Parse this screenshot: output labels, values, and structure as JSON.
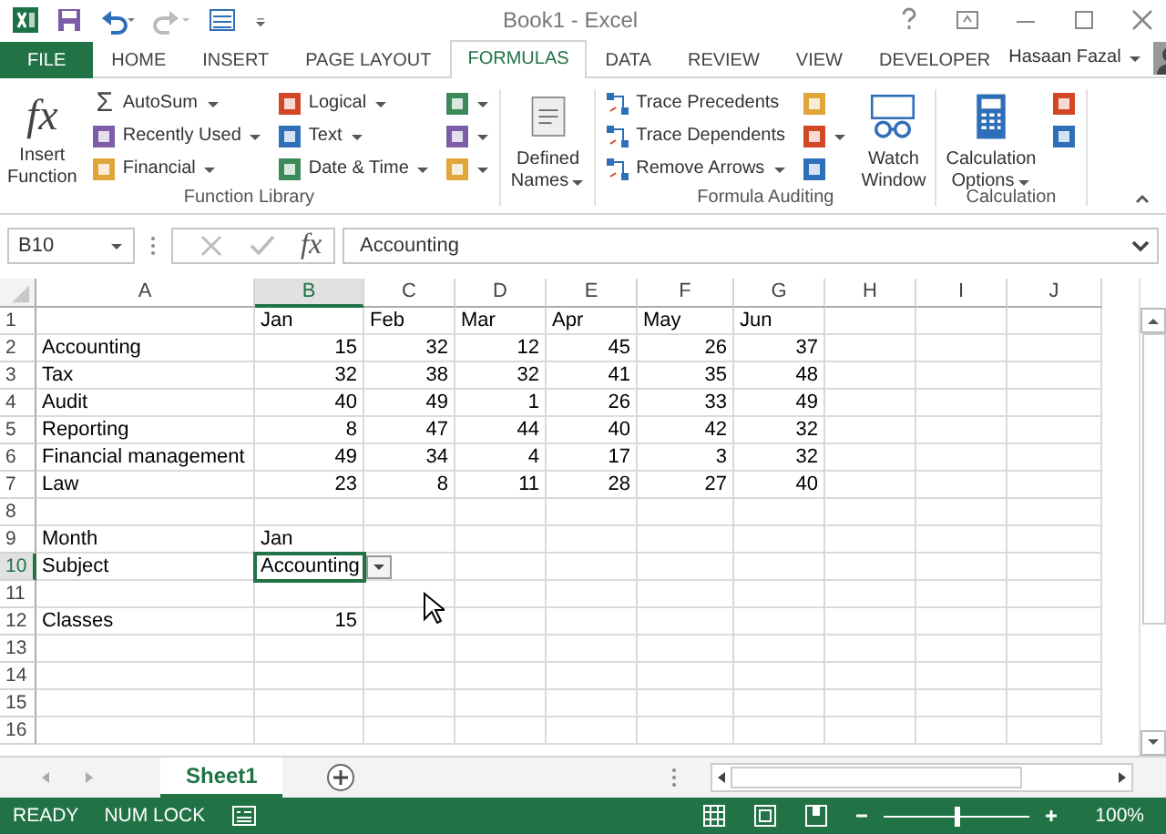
{
  "window": {
    "title": "Book1 - Excel"
  },
  "tabs": [
    {
      "label": "FILE",
      "kind": "file",
      "selected": false
    },
    {
      "label": "HOME",
      "kind": "tab",
      "selected": false
    },
    {
      "label": "INSERT",
      "kind": "tab",
      "selected": false
    },
    {
      "label": "PAGE LAYOUT",
      "kind": "tab",
      "selected": false
    },
    {
      "label": "FORMULAS",
      "kind": "tab",
      "selected": true
    },
    {
      "label": "DATA",
      "kind": "tab",
      "selected": false
    },
    {
      "label": "REVIEW",
      "kind": "tab",
      "selected": false
    },
    {
      "label": "VIEW",
      "kind": "tab",
      "selected": false
    },
    {
      "label": "DEVELOPER",
      "kind": "tab",
      "selected": false
    }
  ],
  "user": {
    "name": "Hasaan Fazal"
  },
  "ribbon": {
    "groups": [
      {
        "label": "Function Library",
        "items": [
          {
            "kind": "large",
            "lines": [
              "Insert",
              "Function"
            ],
            "glyph": "fx",
            "dropdown": false
          },
          {
            "kind": "small",
            "label": "AutoSum",
            "glyph": "Σ",
            "dropdown": true
          },
          {
            "kind": "small",
            "label": "Recently Used",
            "dropdown": true
          },
          {
            "kind": "small",
            "label": "Financial",
            "dropdown": true
          },
          {
            "kind": "small",
            "label": "Logical",
            "dropdown": true
          },
          {
            "kind": "small",
            "label": "Text",
            "dropdown": true
          },
          {
            "kind": "small",
            "label": "Date & Time",
            "dropdown": true
          },
          {
            "kind": "icon",
            "dropdown": true
          },
          {
            "kind": "icon",
            "dropdown": true
          },
          {
            "kind": "icon",
            "dropdown": true
          }
        ]
      },
      {
        "items": [
          {
            "kind": "large",
            "lines": [
              "Defined",
              "Names"
            ],
            "dropdown": true
          }
        ]
      },
      {
        "label": "Formula Auditing",
        "items": [
          {
            "kind": "small",
            "label": "Trace Precedents",
            "dropdown": false
          },
          {
            "kind": "small",
            "label": "Trace Dependents",
            "dropdown": false
          },
          {
            "kind": "small",
            "label": "Remove Arrows",
            "dropdown": true
          },
          {
            "kind": "icon",
            "dropdown": false
          },
          {
            "kind": "icon",
            "dropdown": true
          },
          {
            "kind": "icon",
            "dropdown": false
          },
          {
            "kind": "large",
            "lines": [
              "Watch",
              "Window"
            ],
            "dropdown": false
          }
        ]
      },
      {
        "label": "Calculation",
        "items": [
          {
            "kind": "large",
            "lines": [
              "Calculation",
              "Options"
            ],
            "dropdown": true
          },
          {
            "kind": "icon",
            "dropdown": false
          },
          {
            "kind": "icon",
            "dropdown": false
          }
        ]
      }
    ]
  },
  "formula_bar": {
    "cell_reference": "B10",
    "function_label": "fx",
    "value": "Accounting"
  },
  "sheet": {
    "columns": [
      {
        "label": "A",
        "selected": false
      },
      {
        "label": "B",
        "selected": true
      },
      {
        "label": "C",
        "selected": false
      },
      {
        "label": "D",
        "selected": false
      },
      {
        "label": "E",
        "selected": false
      },
      {
        "label": "F",
        "selected": false
      },
      {
        "label": "G",
        "selected": false
      },
      {
        "label": "H",
        "selected": false
      },
      {
        "label": "I",
        "selected": false
      },
      {
        "label": "J",
        "selected": false
      }
    ],
    "rows": [
      {
        "header": "1",
        "selected": false,
        "cells": [
          null,
          {
            "text": "Jan",
            "kind": "text"
          },
          {
            "text": "Feb",
            "kind": "text"
          },
          {
            "text": "Mar",
            "kind": "text"
          },
          {
            "text": "Apr",
            "kind": "text"
          },
          {
            "text": "May",
            "kind": "text"
          },
          {
            "text": "Jun",
            "kind": "text"
          }
        ]
      },
      {
        "header": "2",
        "selected": false,
        "cells": [
          {
            "text": "Accounting",
            "kind": "text"
          },
          {
            "text": "15",
            "kind": "number"
          },
          {
            "text": "32",
            "kind": "number"
          },
          {
            "text": "12",
            "kind": "number"
          },
          {
            "text": "45",
            "kind": "number"
          },
          {
            "text": "26",
            "kind": "number"
          },
          {
            "text": "37",
            "kind": "number"
          }
        ]
      },
      {
        "header": "3",
        "selected": false,
        "cells": [
          {
            "text": "Tax",
            "kind": "text"
          },
          {
            "text": "32",
            "kind": "number"
          },
          {
            "text": "38",
            "kind": "number"
          },
          {
            "text": "32",
            "kind": "number"
          },
          {
            "text": "41",
            "kind": "number"
          },
          {
            "text": "35",
            "kind": "number"
          },
          {
            "text": "48",
            "kind": "number"
          }
        ]
      },
      {
        "header": "4",
        "selected": false,
        "cells": [
          {
            "text": "Audit",
            "kind": "text"
          },
          {
            "text": "40",
            "kind": "number"
          },
          {
            "text": "49",
            "kind": "number"
          },
          {
            "text": "1",
            "kind": "number"
          },
          {
            "text": "26",
            "kind": "number"
          },
          {
            "text": "33",
            "kind": "number"
          },
          {
            "text": "49",
            "kind": "number"
          }
        ]
      },
      {
        "header": "5",
        "selected": false,
        "cells": [
          {
            "text": "Reporting",
            "kind": "text"
          },
          {
            "text": "8",
            "kind": "number"
          },
          {
            "text": "47",
            "kind": "number"
          },
          {
            "text": "44",
            "kind": "number"
          },
          {
            "text": "40",
            "kind": "number"
          },
          {
            "text": "42",
            "kind": "number"
          },
          {
            "text": "32",
            "kind": "number"
          }
        ]
      },
      {
        "header": "6",
        "selected": false,
        "cells": [
          {
            "text": "Financial management",
            "kind": "text"
          },
          {
            "text": "49",
            "kind": "number"
          },
          {
            "text": "34",
            "kind": "number"
          },
          {
            "text": "4",
            "kind": "number"
          },
          {
            "text": "17",
            "kind": "number"
          },
          {
            "text": "3",
            "kind": "number"
          },
          {
            "text": "32",
            "kind": "number"
          }
        ]
      },
      {
        "header": "7",
        "selected": false,
        "cells": [
          {
            "text": "Law",
            "kind": "text"
          },
          {
            "text": "23",
            "kind": "number"
          },
          {
            "text": "8",
            "kind": "number"
          },
          {
            "text": "11",
            "kind": "number"
          },
          {
            "text": "28",
            "kind": "number"
          },
          {
            "text": "27",
            "kind": "number"
          },
          {
            "text": "40",
            "kind": "number"
          }
        ]
      },
      {
        "header": "8",
        "selected": false,
        "cells": []
      },
      {
        "header": "9",
        "selected": false,
        "cells": [
          {
            "text": "Month",
            "kind": "text"
          },
          {
            "text": "Jan",
            "kind": "text"
          }
        ]
      },
      {
        "header": "10",
        "selected": true,
        "cells": [
          {
            "text": "Subject",
            "kind": "text"
          },
          {
            "text": "Accounting",
            "kind": "dropdown"
          }
        ]
      },
      {
        "header": "11",
        "selected": false,
        "cells": []
      },
      {
        "header": "12",
        "selected": false,
        "cells": [
          {
            "text": "Classes",
            "kind": "text"
          },
          {
            "text": "15",
            "kind": "number"
          }
        ]
      },
      {
        "header": "13",
        "selected": false,
        "cells": []
      },
      {
        "header": "14",
        "selected": false,
        "cells": []
      },
      {
        "header": "15",
        "selected": false,
        "cells": []
      },
      {
        "header": "16",
        "selected": false,
        "cells": []
      }
    ]
  },
  "sheet_tabs": [
    {
      "label": "Sheet1",
      "selected": true
    }
  ],
  "status_bar": {
    "items": [
      "READY",
      "NUM LOCK"
    ],
    "zoom": {
      "level": 0.5,
      "reading": "100%"
    }
  }
}
